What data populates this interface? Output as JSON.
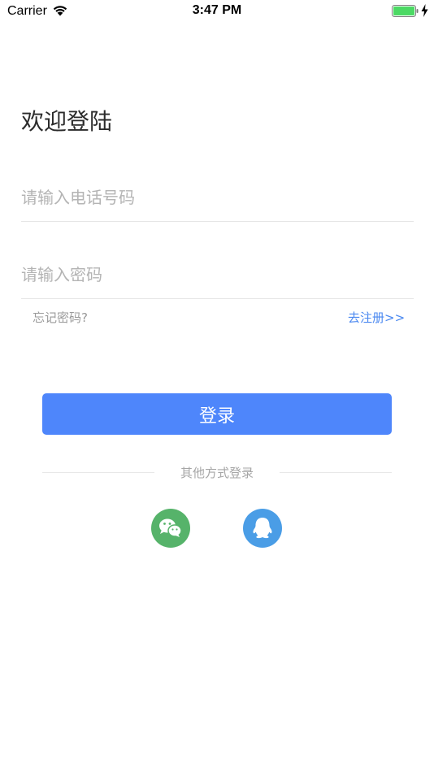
{
  "status_bar": {
    "carrier": "Carrier",
    "time": "3:47 PM",
    "battery_color": "#4cd964"
  },
  "title": "欢迎登陆",
  "phone": {
    "placeholder": "请输入电话号码",
    "value": ""
  },
  "password": {
    "placeholder": "请输入密码",
    "value": ""
  },
  "forgot_label": "忘记密码?",
  "register_label": "去注册>>",
  "login_label": "登录",
  "other_login_label": "其他方式登录",
  "social": [
    {
      "name": "wechat",
      "icon": "wechat-icon",
      "color": "#56b36a"
    },
    {
      "name": "qq",
      "icon": "qq-icon",
      "color": "#4a9de6"
    }
  ],
  "colors": {
    "accent": "#4e86fb",
    "link": "#4a88f0"
  }
}
